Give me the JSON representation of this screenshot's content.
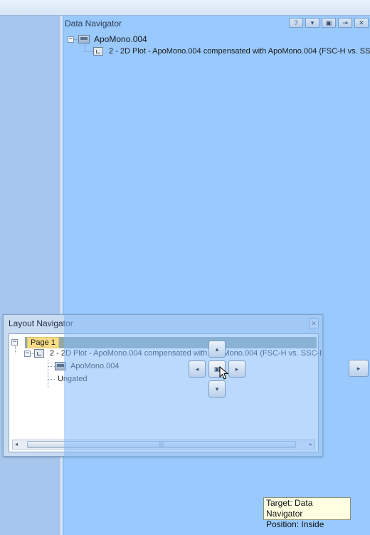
{
  "data_navigator": {
    "title": "Data Navigator",
    "buttons": [
      "?",
      "▾",
      "▣",
      "⇥",
      "✕"
    ],
    "tree": {
      "root": "ApoMono.004",
      "child": "2 - 2D Plot - ApoMono.004 compensated with ApoMono.004 (FSC-H vs. SSC-"
    }
  },
  "layout_navigator": {
    "title": "Layout Navigator",
    "close": "✕",
    "page": "Page 1",
    "plot": "2 - 2D Plot - ApoMono.004 compensated with ApoMono.004 (FSC-H vs. SSC-I",
    "data_file": "ApoMono.004",
    "gate": "Ungated",
    "scroll_grip": "|||"
  },
  "dock_guides": {
    "top": "▴",
    "bottom": "▾",
    "left": "◂",
    "right": "▸",
    "center": "▣",
    "edge_right": "▸"
  },
  "tooltip": {
    "line1": "Target: Data Navigator",
    "line2": "Position: Inside"
  }
}
